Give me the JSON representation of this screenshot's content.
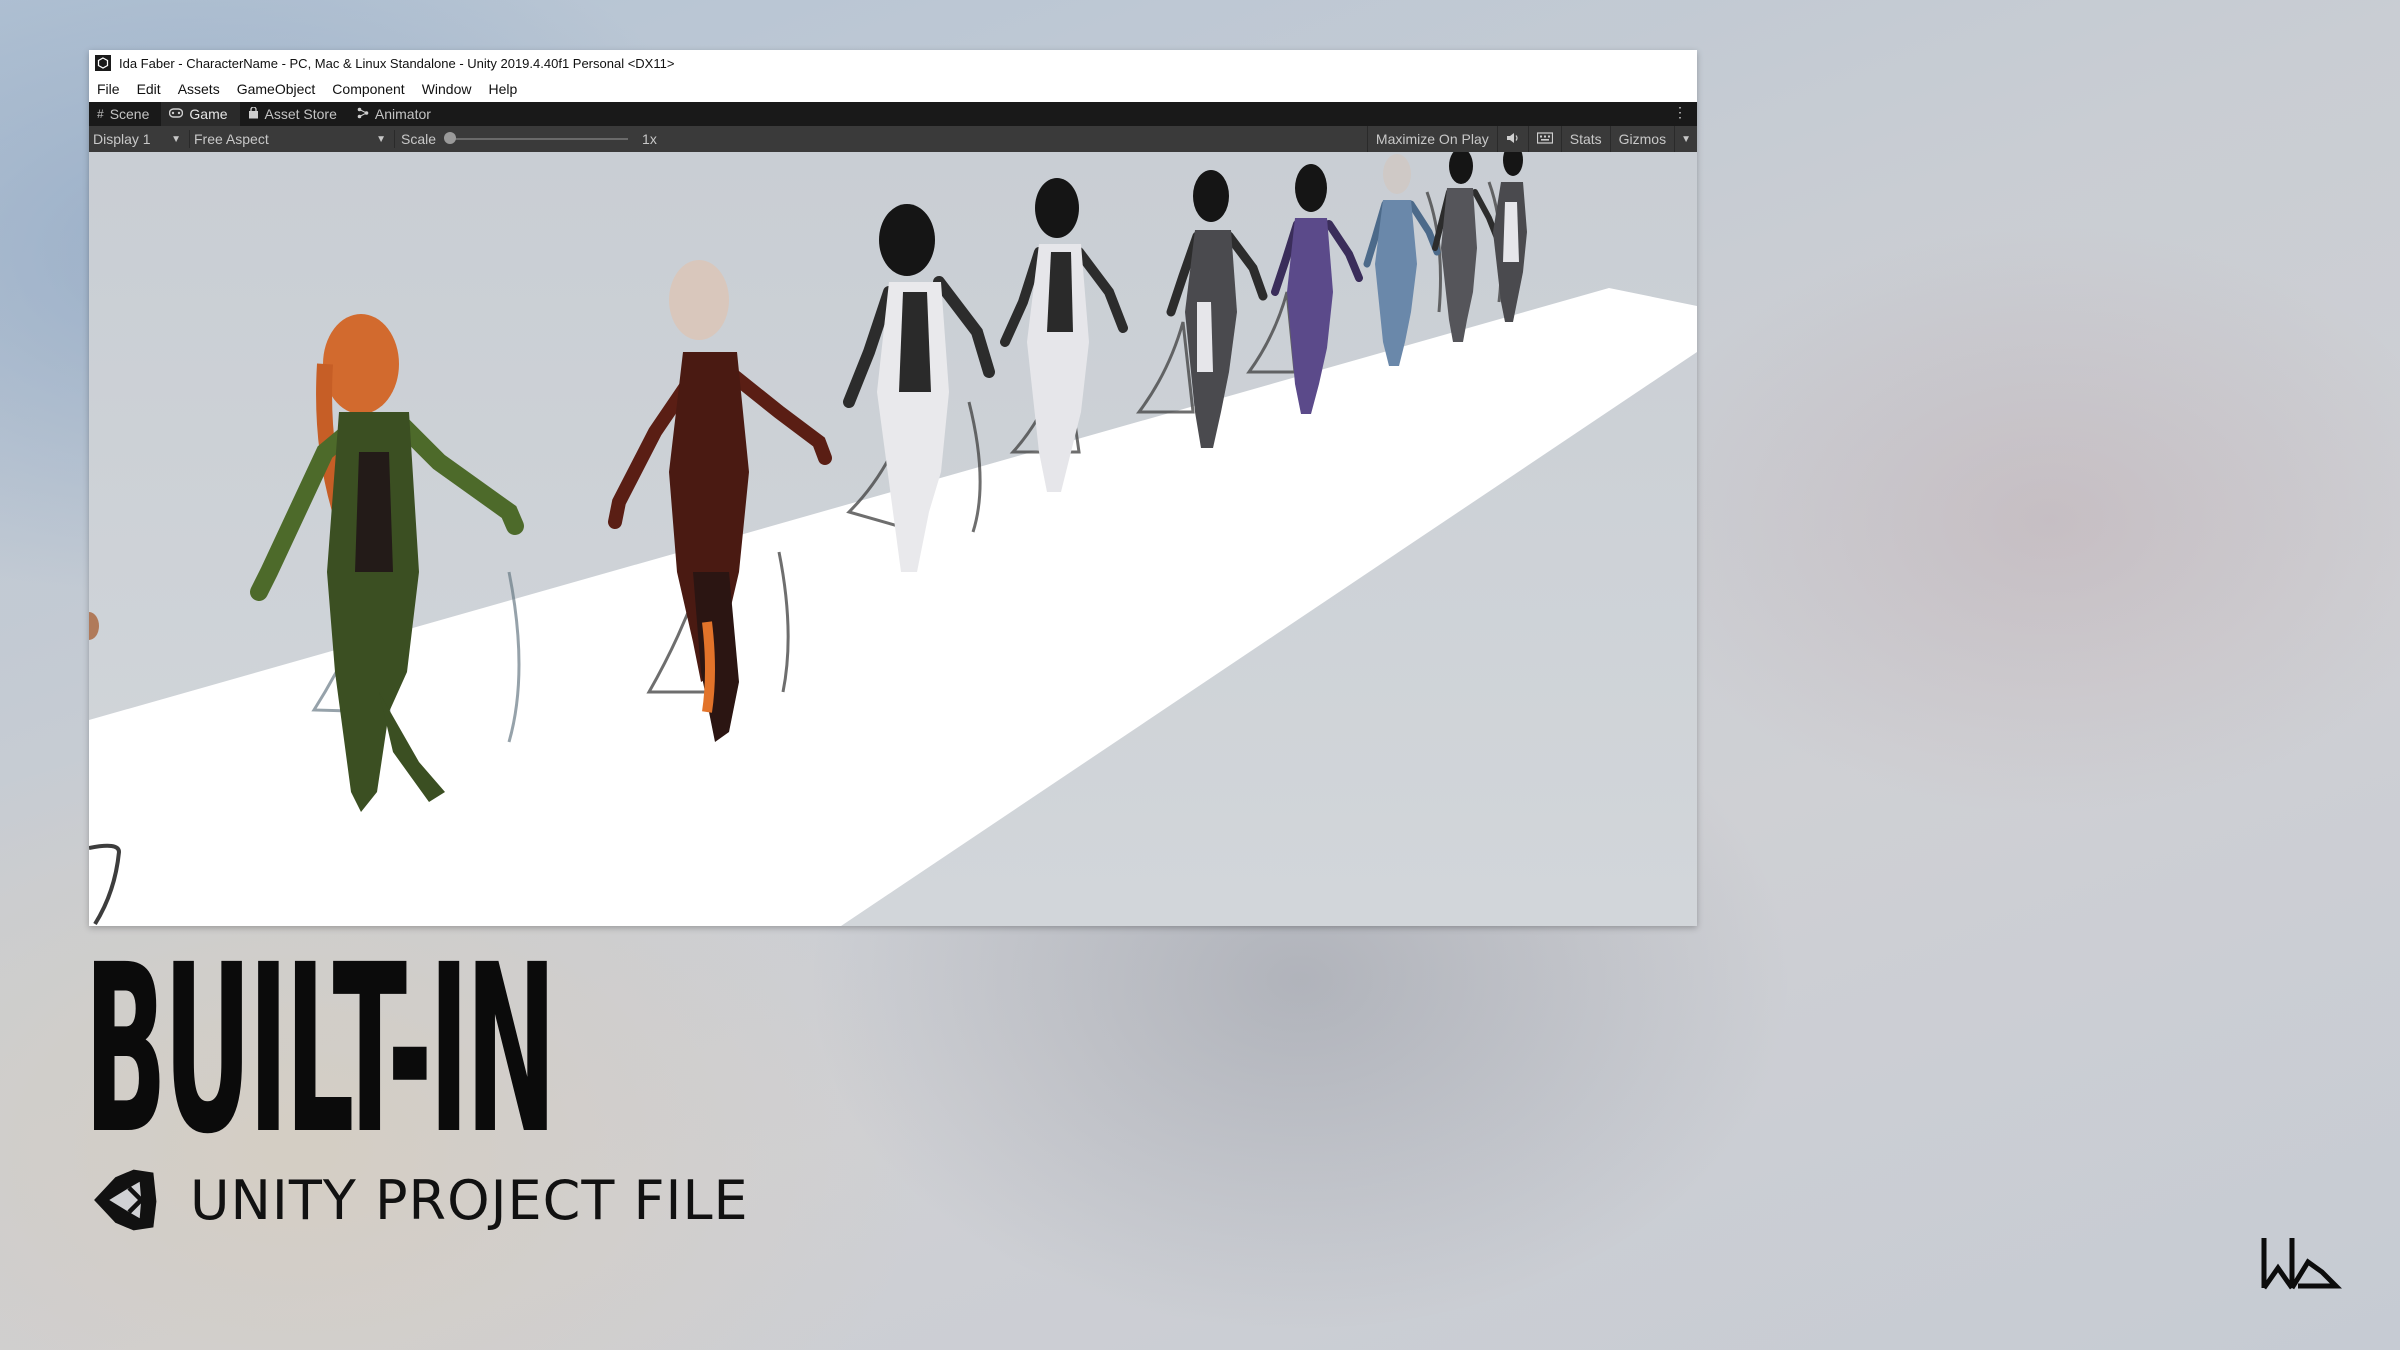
{
  "window": {
    "title": "Ida Faber - CharacterName - PC, Mac & Linux Standalone - Unity 2019.4.40f1 Personal <DX11>"
  },
  "menu": [
    "File",
    "Edit",
    "Assets",
    "GameObject",
    "Component",
    "Window",
    "Help"
  ],
  "tabs": [
    {
      "label": "Scene",
      "icon": "grid-icon"
    },
    {
      "label": "Game",
      "icon": "gamepad-icon",
      "active": true
    },
    {
      "label": "Asset Store",
      "icon": "shopping-bag-icon"
    },
    {
      "label": "Animator",
      "icon": "animator-icon"
    }
  ],
  "toolbar": {
    "display": "Display 1",
    "aspect": "Free Aspect",
    "scale_label": "Scale",
    "scale_value": "1x",
    "maximize": "Maximize On Play",
    "stats": "Stats",
    "gizmos": "Gizmos"
  },
  "hero": {
    "title": "BUILT-IN",
    "subtitle": "UNITY PROJECT FILE"
  },
  "colors": {
    "editor_dark": "#191919",
    "toolbar": "#3a3a3a",
    "floor": "#ffffff",
    "background": "#cdd1d6"
  }
}
